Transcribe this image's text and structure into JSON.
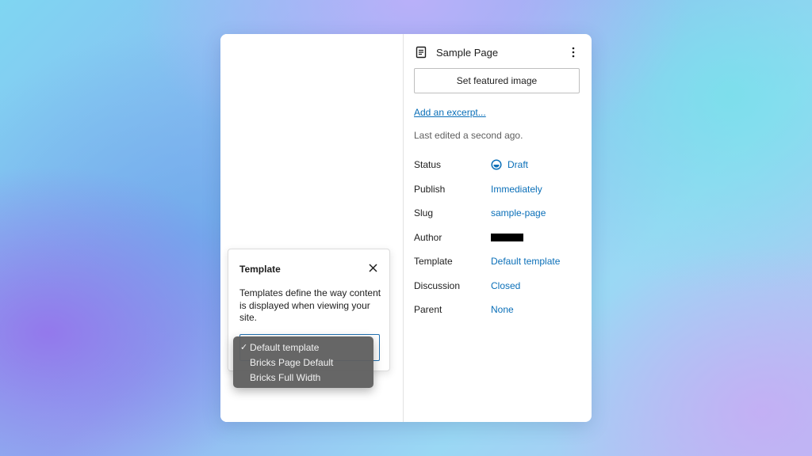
{
  "sidebar": {
    "title": "Sample Page",
    "featured_image_button": "Set featured image",
    "excerpt_link": "Add an excerpt...",
    "last_edited": "Last edited a second ago.",
    "rows": [
      {
        "label": "Status",
        "value": "Draft",
        "icon": "draft-status-icon"
      },
      {
        "label": "Publish",
        "value": "Immediately"
      },
      {
        "label": "Slug",
        "value": "sample-page"
      },
      {
        "label": "Author",
        "value": "",
        "redacted": true
      },
      {
        "label": "Template",
        "value": "Default template"
      },
      {
        "label": "Discussion",
        "value": "Closed"
      },
      {
        "label": "Parent",
        "value": "None"
      }
    ]
  },
  "template_popover": {
    "title": "Template",
    "description": "Templates define the way content is displayed when viewing your site.",
    "options": [
      {
        "label": "Default template",
        "selected": true
      },
      {
        "label": "Bricks Page Default",
        "selected": false
      },
      {
        "label": "Bricks Full Width",
        "selected": false
      }
    ],
    "check_mark": "✓"
  },
  "colors": {
    "link": "#0a6fb8",
    "focus_border": "#2271b1",
    "dropdown_bg": "#606060"
  }
}
